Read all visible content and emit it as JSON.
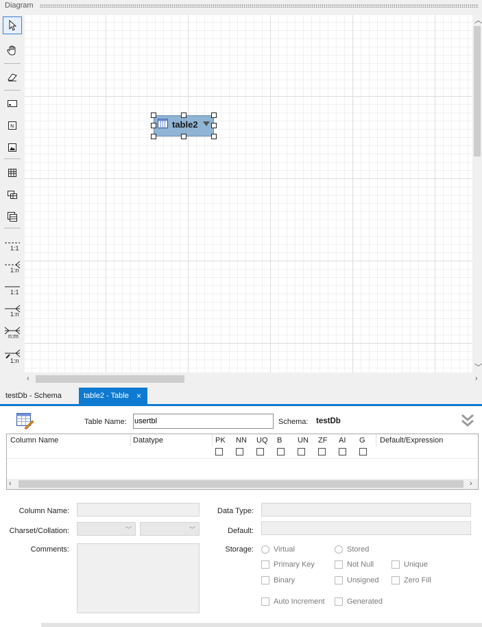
{
  "diagram": {
    "title": "Diagram",
    "table_widget": {
      "label": "table2"
    }
  },
  "toolbar": {
    "relations": [
      "1:1",
      "1:n",
      "1:1",
      "1:n",
      "n:m",
      "1:n"
    ]
  },
  "tabs": [
    {
      "label": "testDb - Schema",
      "active": false
    },
    {
      "label": "table2 - Table",
      "active": true,
      "close": "×"
    }
  ],
  "editor": {
    "table_name_label": "Table Name:",
    "table_name_value": "usertbl",
    "schema_label": "Schema:",
    "schema_value": "testDb",
    "grid": {
      "headers": [
        "Column Name",
        "Datatype",
        "PK",
        "NN",
        "UQ",
        "B",
        "UN",
        "ZF",
        "AI",
        "G",
        "Default/Expression"
      ]
    },
    "details": {
      "column_name_label": "Column Name:",
      "charset_label": "Charset/Collation:",
      "comments_label": "Comments:",
      "data_type_label": "Data Type:",
      "default_label": "Default:",
      "storage_label": "Storage:",
      "virtual": "Virtual",
      "stored": "Stored",
      "primary_key": "Primary Key",
      "not_null": "Not Null",
      "unique": "Unique",
      "binary": "Binary",
      "unsigned": "Unsigned",
      "zero_fill": "Zero Fill",
      "auto_increment": "Auto Increment",
      "generated": "Generated"
    }
  },
  "colors": {
    "accent": "#0e7ad1",
    "table_fill": "#8fb4d4"
  }
}
